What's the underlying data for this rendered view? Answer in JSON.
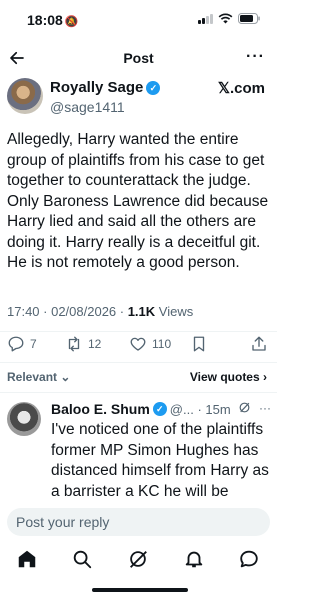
{
  "status_bar": {
    "time": "18:08"
  },
  "header": {
    "title": "Post"
  },
  "post": {
    "author_name": "Royally Sage",
    "author_handle": "@sage1411",
    "source_label": "𝕏.com",
    "text": "Allegedly, Harry wanted the entire group of plaintiffs from his case to get together to counterattack the judge. Only Baroness Lawrence did because Harry lied and said all the others are doing it. Harry really is a deceitful git. He is not remotely a good person.",
    "timestamp": "17:40 · 02/08/2026 · ",
    "views_count": "1.1K",
    "views_label": " Views",
    "replies_count": "7",
    "reposts_count": "12",
    "likes_count": "110"
  },
  "sort": {
    "relevant_label": "Relevant ⌄",
    "view_quotes_label": "View quotes ›"
  },
  "reply": {
    "author_name": "Baloo E. Shum",
    "meta": "@... · 15m",
    "text": "I've noticed one of the plaintiffs former MP Simon Hughes has distanced himself from Harry as a barrister a KC he will be aware of the implabilityof making"
  },
  "composer": {
    "placeholder": "Post your reply"
  },
  "colors": {
    "accent": "#1d9bf0",
    "text": "#0f1419",
    "muted": "#536471"
  },
  "icons": [
    "back-arrow-icon",
    "more-icon",
    "verified-icon",
    "reply-icon",
    "repost-icon",
    "like-icon",
    "bookmark-icon",
    "share-icon",
    "grok-icon",
    "home-icon",
    "search-icon",
    "notifications-icon",
    "messages-icon"
  ]
}
